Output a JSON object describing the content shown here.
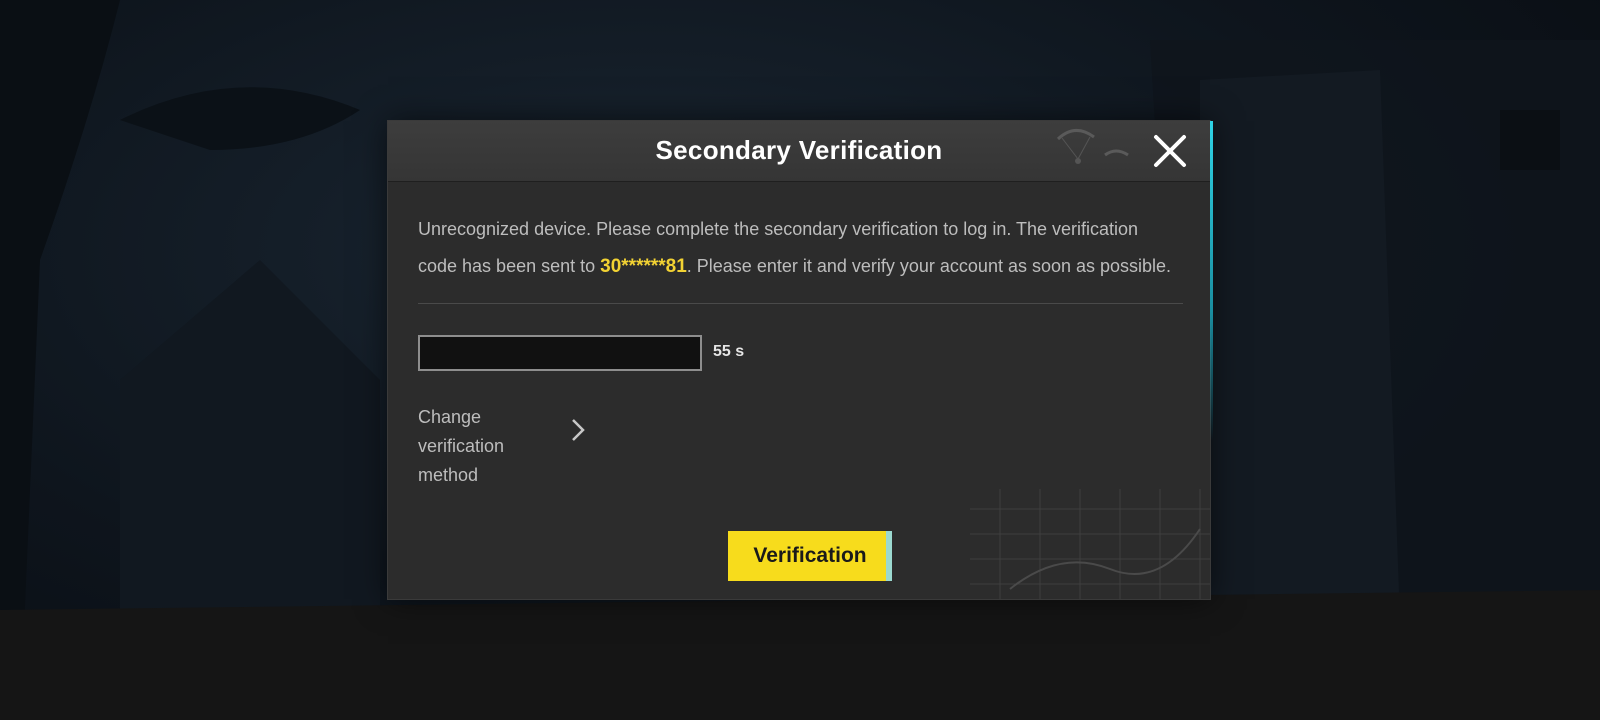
{
  "dialog": {
    "title": "Secondary Verification",
    "message_part1": "Unrecognized device. Please complete the secondary verification to log in. The verification code has been sent to ",
    "phone_masked": "30******81",
    "message_part2": ". Please enter it and verify your account as soon as possible.",
    "code_input": {
      "value": "",
      "placeholder": ""
    },
    "countdown": "55 s",
    "change_method_label": "Change verification method",
    "verify_button_label": "Verification",
    "close_icon": "close-icon",
    "chevron_icon": "chevron-right-icon"
  },
  "colors": {
    "accent_yellow": "#f7dc1c",
    "highlight_text": "#f2d233",
    "dialog_bg": "#2c2c2c"
  }
}
